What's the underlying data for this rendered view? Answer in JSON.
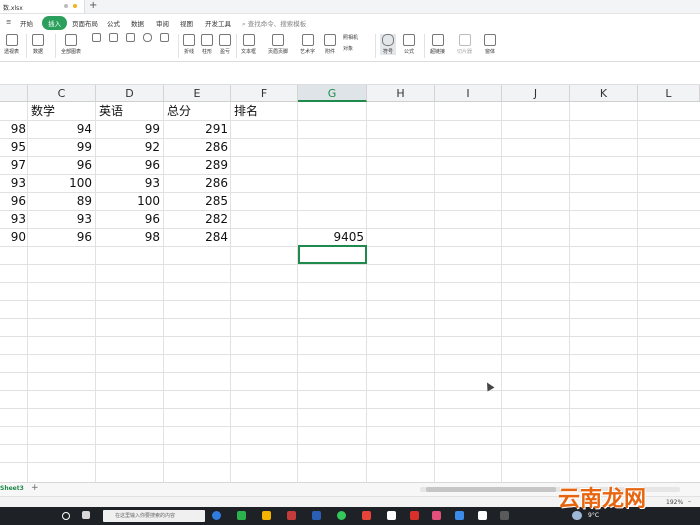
{
  "window": {
    "doc_tab": "数.xlsx",
    "new_tab": "+"
  },
  "menu": {
    "items": [
      "开始",
      "插入",
      "页面布局",
      "公式",
      "数据",
      "审阅",
      "视图",
      "开发工具"
    ],
    "active": "插入",
    "search_placeholder": "查找命令、搜索模板"
  },
  "ribbon": {
    "groups": [
      "透视表",
      "数据",
      "全部图表",
      "折线",
      "柱形",
      "盈亏",
      "文本框",
      "页眉页脚",
      "艺术字",
      "附件",
      "对象",
      "照相机",
      "符号",
      "公式",
      "超链接",
      "切片器",
      "窗体"
    ]
  },
  "sheet": {
    "columns": [
      "C",
      "D",
      "E",
      "F",
      "G",
      "H",
      "I",
      "J",
      "K",
      "L"
    ],
    "selected_column": "G",
    "rows": [
      {
        "b": "",
        "c": "数学",
        "d": "英语",
        "e": "总分",
        "f": "排名",
        "g": ""
      },
      {
        "b": "98",
        "c": "94",
        "d": "99",
        "e": "291",
        "f": "",
        "g": ""
      },
      {
        "b": "95",
        "c": "99",
        "d": "92",
        "e": "286",
        "f": "",
        "g": ""
      },
      {
        "b": "97",
        "c": "96",
        "d": "96",
        "e": "289",
        "f": "",
        "g": ""
      },
      {
        "b": "93",
        "c": "100",
        "d": "93",
        "e": "286",
        "f": "",
        "g": ""
      },
      {
        "b": "96",
        "c": "89",
        "d": "100",
        "e": "285",
        "f": "",
        "g": ""
      },
      {
        "b": "93",
        "c": "93",
        "d": "96",
        "e": "282",
        "f": "",
        "g": ""
      },
      {
        "b": "90",
        "c": "96",
        "d": "98",
        "e": "284",
        "f": "",
        "g": "9405"
      }
    ]
  },
  "sheetbar": {
    "tab": "Sheet3",
    "add": "+"
  },
  "status": {
    "zoom": "192%"
  },
  "taskbar": {
    "search_placeholder": "在这里输入你要搜索的内容",
    "temperature": "9°C"
  },
  "watermark": "云南龙网",
  "colors": {
    "accent": "#1f8a4c",
    "menu_active_bg": "#2aa05c"
  }
}
